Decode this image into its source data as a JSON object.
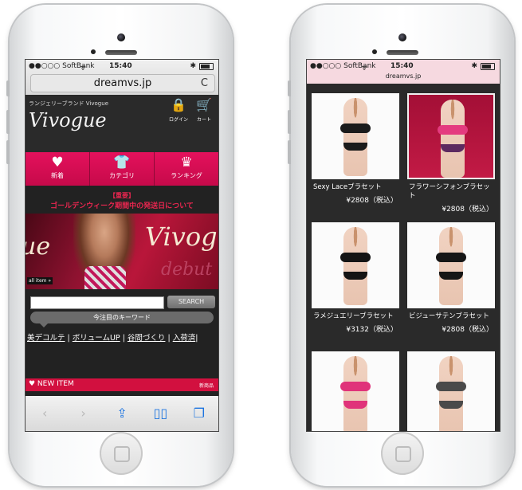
{
  "left_phone": {
    "status": {
      "carrier": "●●○○○ SoftBank",
      "wifi": "ᯤ",
      "time": "15:40",
      "bluetooth": "✱"
    },
    "url": "dreamvs.jp",
    "reload_glyph": "C",
    "site": {
      "subtitle": "ランジェリーブランド Vivogue",
      "logo": "Vivogue",
      "login_label": "ログイン",
      "cart_label": "カート"
    },
    "nav": [
      {
        "label": "新着",
        "icon": "heart-icon",
        "glyph": "♥"
      },
      {
        "label": "カテゴリ",
        "icon": "tshirt-icon",
        "glyph": "👕"
      },
      {
        "label": "ランキング",
        "icon": "crown-icon",
        "glyph": "♛"
      }
    ],
    "notice": {
      "tag": "【重要】",
      "text": "ゴールデンウィーク期間中の発送日について"
    },
    "banner": {
      "text_left": "ue",
      "text_right": "Vivog",
      "debut": "debut",
      "all_item": "all item »"
    },
    "search_button": "SEARCH",
    "keyword_header": "今注目のキーワード",
    "keywords": [
      "美デコルテ",
      "ボリュームUP",
      "谷間づくり",
      "入荷済"
    ],
    "new_item": {
      "title": "♥ NEW ITEM",
      "sub": "新商品"
    }
  },
  "right_phone": {
    "status": {
      "carrier": "●●○○○ SoftBank",
      "wifi": "ᯤ",
      "time": "15:40",
      "bluetooth": "✱"
    },
    "url": "dreamvs.jp",
    "products": [
      {
        "name": "Sexy Laceブラセット",
        "price": "¥2808（税込）",
        "top_color": "#1b1b1b",
        "bottom_color": "#1b1b1b"
      },
      {
        "name": "フラワーシフォンブラセット",
        "price": "¥2808（税込）",
        "top_color": "#e43b7f",
        "bottom_color": "#5c2a60"
      },
      {
        "name": "ラメジュエリーブラセット",
        "price": "¥3132（税込）",
        "top_color": "#141414",
        "bottom_color": "#141414"
      },
      {
        "name": "ビジューサテンブラセット",
        "price": "¥2808（税込）",
        "top_color": "#161616",
        "bottom_color": "#161616"
      },
      {
        "name": "",
        "price": "",
        "top_color": "#e0337a",
        "bottom_color": "#e0337a"
      },
      {
        "name": "",
        "price": "",
        "top_color": "#4a4a4a",
        "bottom_color": "#4a4a4a"
      }
    ]
  }
}
